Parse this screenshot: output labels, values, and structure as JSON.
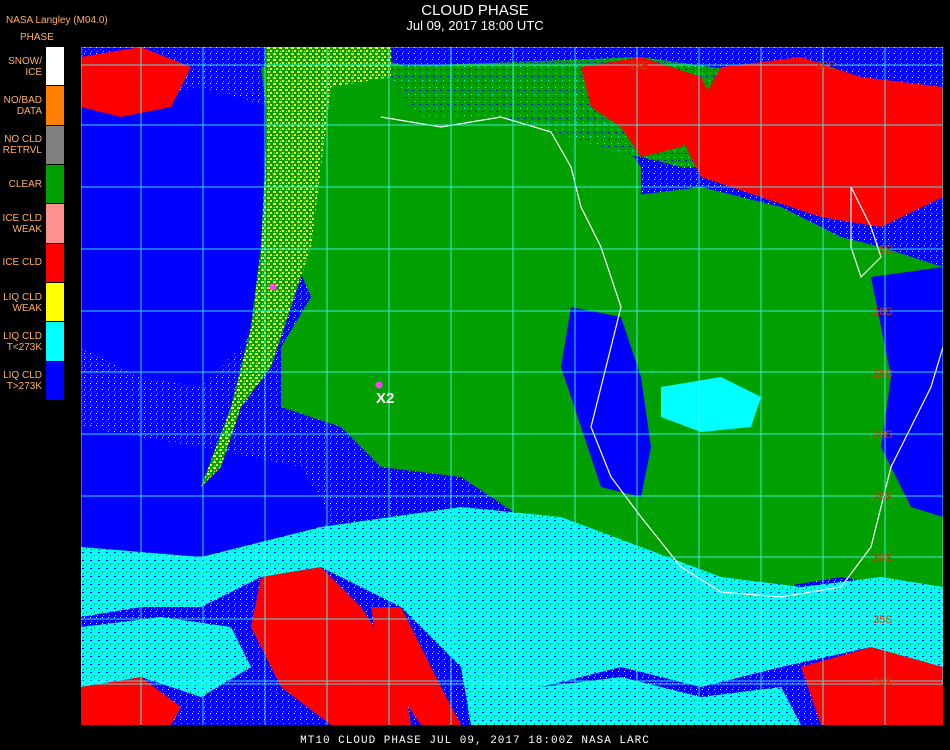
{
  "header": {
    "title": "CLOUD PHASE",
    "subtitle": "Jul 09, 2017 18:00 UTC",
    "provider": "NASA Langley (M04.0)",
    "legend_title": "PHASE"
  },
  "legend": [
    {
      "label": "SNOW/\nICE",
      "color": "#ffffff"
    },
    {
      "label": "NO/BAD\nDATA",
      "color": "#ff8000"
    },
    {
      "label": "NO CLD\nRETRVL",
      "color": "#808080"
    },
    {
      "label": "CLEAR",
      "color": "#00a000"
    },
    {
      "label": "ICE CLD\nWEAK",
      "color": "#ff9090"
    },
    {
      "label": "ICE CLD",
      "color": "#ff0000"
    },
    {
      "label": "LIQ CLD\nWEAK",
      "color": "#ffff00"
    },
    {
      "label": "LIQ CLD\nT<273K",
      "color": "#00ffff"
    },
    {
      "label": "LIQ CLD\nT>273K",
      "color": "#0000ff"
    }
  ],
  "map": {
    "marker_label": "X2",
    "lat_labels": [
      "15E",
      "30E",
      "5S",
      "10S",
      "15S",
      "20S",
      "25S",
      "30S",
      "35S",
      "40S"
    ]
  },
  "footer": {
    "text": "MT10  CLOUD PHASE   JUL 09, 2017 18:00Z   NASA LARC"
  }
}
